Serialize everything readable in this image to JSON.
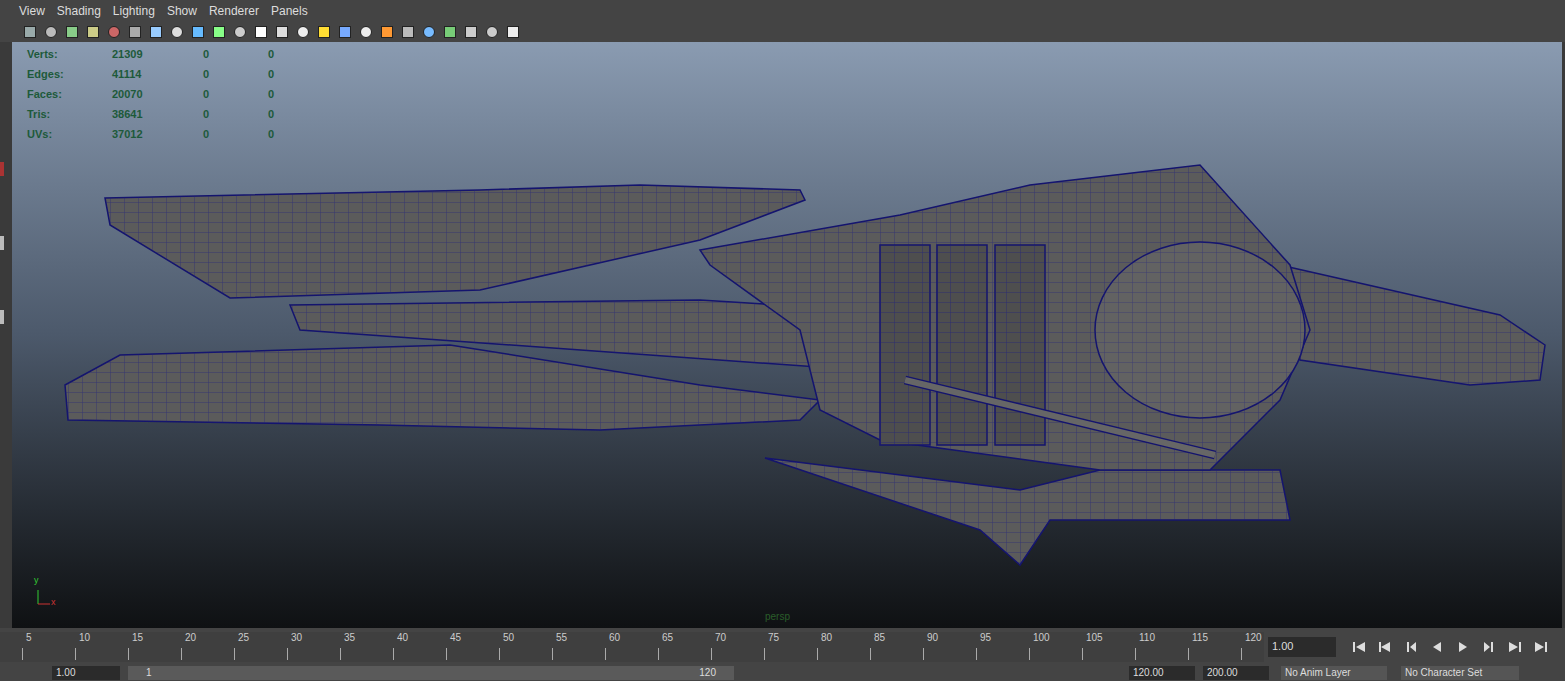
{
  "window": {
    "title": "persp"
  },
  "menu": [
    {
      "label": "View"
    },
    {
      "label": "Shading"
    },
    {
      "label": "Lighting"
    },
    {
      "label": "Show"
    },
    {
      "label": "Renderer"
    },
    {
      "label": "Panels"
    }
  ],
  "hud": [
    {
      "label": "Verts:",
      "values": [
        "21309",
        "0",
        "0"
      ]
    },
    {
      "label": "Edges:",
      "values": [
        "41114",
        "0",
        "0"
      ]
    },
    {
      "label": "Faces:",
      "values": [
        "20070",
        "0",
        "0"
      ]
    },
    {
      "label": "Tris:",
      "values": [
        "38641",
        "0",
        "0"
      ]
    },
    {
      "label": "UVs:",
      "values": [
        "37012",
        "0",
        "0"
      ]
    }
  ],
  "axis": {
    "y": "y",
    "x": "x"
  },
  "camera_label": "persp",
  "timeline": {
    "ticks": [
      "5",
      "10",
      "15",
      "20",
      "25",
      "30",
      "35",
      "40",
      "45",
      "50",
      "55",
      "60",
      "65",
      "70",
      "75",
      "80",
      "85",
      "90",
      "95",
      "100",
      "105",
      "110",
      "115",
      "120"
    ],
    "current_frame": "1.00"
  },
  "range_bar": {
    "start_field": "1.00",
    "slider_start": "1",
    "slider_end": "120",
    "end_field": "120.00",
    "max_field": "200.00",
    "anim_layer": "No Anim Layer",
    "character_set": "No Character Set"
  }
}
